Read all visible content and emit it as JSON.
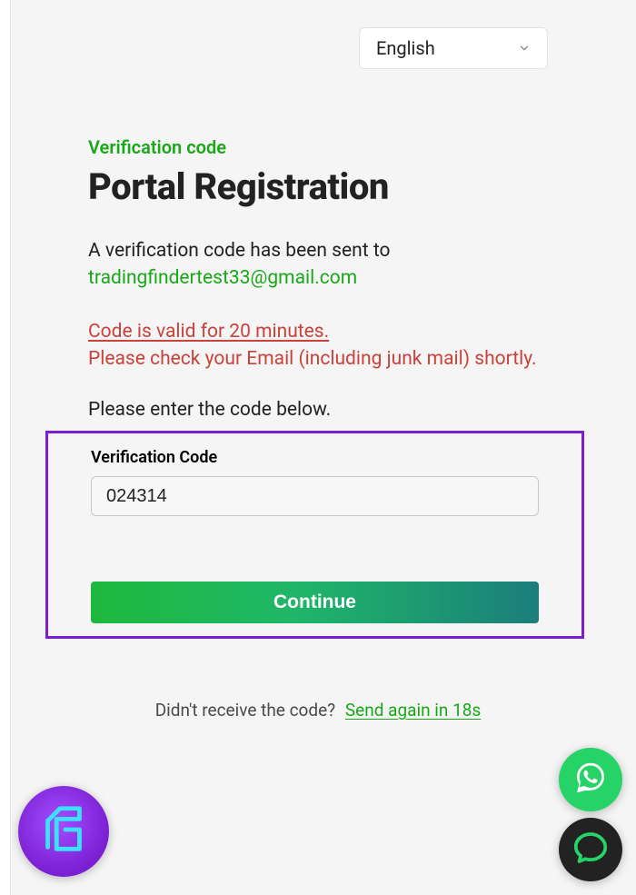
{
  "language": {
    "selected": "English"
  },
  "page": {
    "eyebrow": "Verification code",
    "title": "Portal Registration",
    "sent_prefix": "A verification code has been sent to",
    "email": "tradingfindertest33@gmail.com",
    "validity_line": "Code is valid for 20 minutes.",
    "check_line": "Please check your Email (including junk mail) shortly.",
    "prompt": "Please enter the code below."
  },
  "form": {
    "code_label": "Verification Code",
    "code_value": "024314",
    "continue_label": "Continue"
  },
  "resend": {
    "prefix": "Didn't receive the code?",
    "link_label": "Send again in 18s"
  }
}
